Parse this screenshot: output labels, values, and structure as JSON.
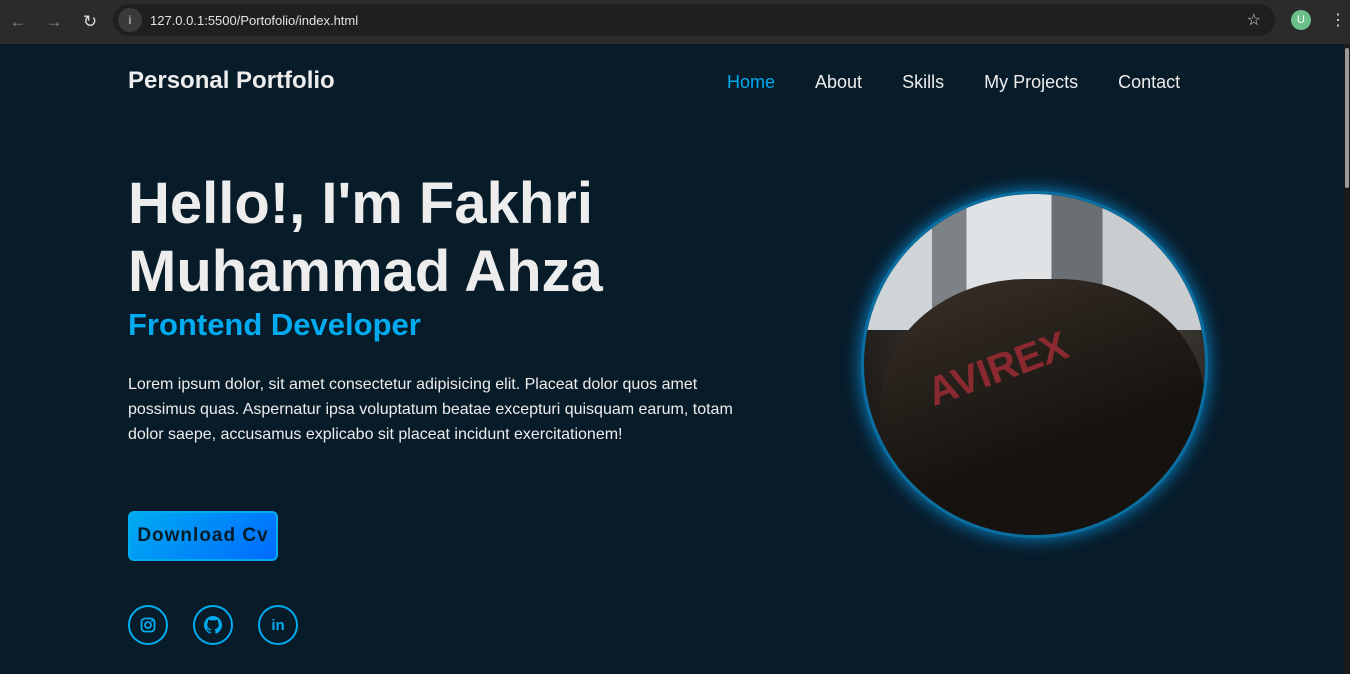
{
  "browser": {
    "url": "127.0.0.1:5500/Portofolio/index.html",
    "avatar_letter": "U"
  },
  "header": {
    "logo": "Personal Portfolio",
    "nav": [
      {
        "label": "Home",
        "active": true
      },
      {
        "label": "About"
      },
      {
        "label": "Skills"
      },
      {
        "label": "My Projects"
      },
      {
        "label": "Contact"
      }
    ]
  },
  "hero": {
    "title": "Hello!, I'm Fakhri Muhammad Ahza",
    "subtitle": "Frontend Developer",
    "description": "Lorem ipsum dolor, sit amet consectetur adipisicing elit. Placeat dolor quos amet possimus quas. Aspernatur ipsa voluptatum beatae excepturi quisquam earum, totam dolor saepe, accusamus explicabo sit placeat incidunt exercitationem!",
    "button": "Download Cv",
    "photo_text": "AVIREX",
    "socials": [
      "instagram",
      "github",
      "linkedin"
    ]
  },
  "colors": {
    "background": "#081b29",
    "accent": "#00abf0"
  }
}
